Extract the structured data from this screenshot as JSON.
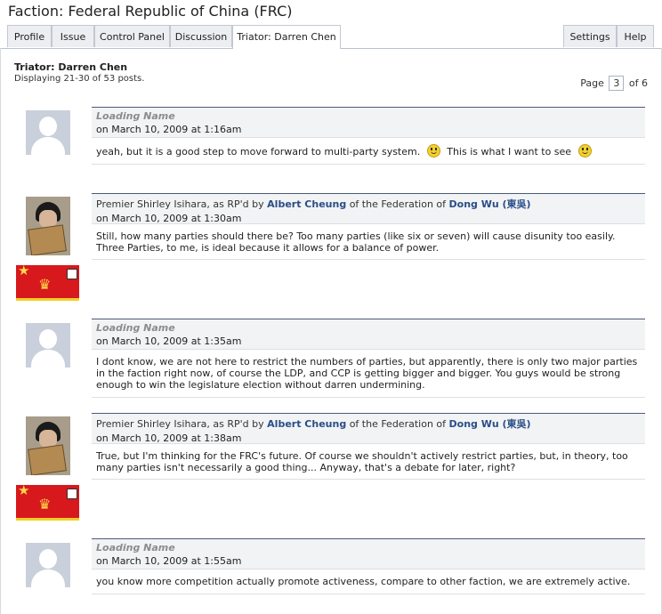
{
  "page": {
    "title": "Faction: Federal Republic of China (FRC)",
    "tabs": {
      "profile": "Profile",
      "issue": "Issue",
      "control_panel": "Control Panel",
      "discussion": "Discussion",
      "active_thread": "Triator: Darren Chen",
      "settings": "Settings",
      "help": "Help"
    },
    "heading": "Triator: Darren Chen",
    "subheading": "Displaying 21-30 of 53 posts.",
    "pager": {
      "prefix": "Page",
      "current": "3",
      "suffix": "of 6"
    }
  },
  "posts": [
    {
      "author_text": "Loading Name",
      "date": "on March 10, 2009 at 1:16am",
      "body_a": "yeah, but it is a good step to move forward to multi-party system.",
      "body_b": "This is what I want to see"
    },
    {
      "prefix": "Premier Shirley Isihara, as RP'd by",
      "author": "Albert Cheung",
      "middle": "of the Federation of",
      "nation": "Dong Wu (東吳)",
      "date": "on March 10, 2009 at 1:30am",
      "body": "Still, how many parties should there be? Too many parties (like six or seven) will cause disunity too easily. Three Parties, to me, is ideal because it allows for a balance of power."
    },
    {
      "author_text": "Loading Name",
      "date": "on March 10, 2009 at 1:35am",
      "body": "I dont know, we are not here to restrict the numbers of parties, but apparently, there is only two major parties in the faction right now, of course the LDP, and CCP is getting bigger and bigger. You guys would be strong enough to win the legislature election without darren undermining."
    },
    {
      "prefix": "Premier Shirley Isihara, as RP'd by",
      "author": "Albert Cheung",
      "middle": "of the Federation of",
      "nation": "Dong Wu (東吳)",
      "date": "on March 10, 2009 at 1:38am",
      "body": "True, but I'm thinking for the FRC's future. Of course we shouldn't actively restrict parties, but, in theory, too many parties isn't necessarily a good thing... Anyway, that's a debate for later, right?"
    },
    {
      "author_text": "Loading Name",
      "date": "on March 10, 2009 at 1:55am",
      "body": "you know more competition actually promote activeness, compare to other faction, we are extremely active."
    }
  ],
  "colors": {
    "link": "#2a4e87",
    "header_rule": "#4a5b78",
    "flag_red": "#d7181d",
    "flag_gold": "#f1cf27"
  }
}
